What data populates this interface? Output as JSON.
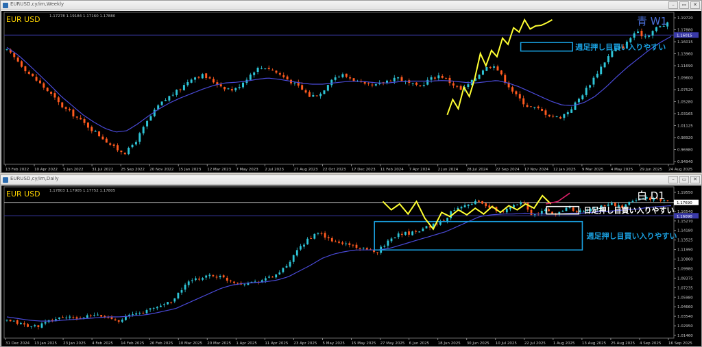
{
  "windows": [
    {
      "id": "weekly",
      "title": "EURUSD,cy/im,Weekly",
      "symbol_label": "EUR USD",
      "ohlc_text": "1.17278 1.19184 1.17160 1.17880",
      "corner_label": "青 W1",
      "annotation": "週足押し目買い入りやすい",
      "price_ticks": [
        "1.19720",
        "1.17880",
        "1.16015",
        "1.13960",
        "1.11690",
        "1.09600",
        "1.07520",
        "1.05280",
        "1.03165",
        "1.01125",
        "0.98920",
        "0.96980",
        "0.94940"
      ],
      "date_ticks": [
        "13 Feb 2022",
        "10 Apr 2022",
        "5 Jun 2022",
        "31 Jul 2022",
        "25 Sep 2022",
        "20 Nov 2022",
        "15 Jan 2023",
        "12 Mar 2023",
        "7 May 2023",
        "2 Jul 2023",
        "27 Aug 2023",
        "22 Oct 2023",
        "17 Dec 2023",
        "11 Feb 2024",
        "7 Apr 2024",
        "2 Jun 2024",
        "28 Jul 2024",
        "22 Sep 2024",
        "17 Nov 2024",
        "12 Jan 2025",
        "9 Mar 2025",
        "4 May 2025",
        "29 Jun 2025",
        "24 Aug 2025"
      ],
      "colors": {
        "up": "#2ec4d6",
        "down": "#ff5a1f",
        "ma": "#4a4ad8",
        "zigzag": "#ffff33",
        "zone": "#1aa0e0",
        "hline": "#3a3aa8"
      }
    },
    {
      "id": "daily",
      "title": "EURUSD,cy/im,Daily",
      "symbol_label": "EUR USD",
      "ohlc_text": "1.17803 1.17905 1.17752 1.17805",
      "corner_label": "白 D1",
      "annotation_white": "日足押し目買い入りやすい",
      "annotation_blue": "週足押し目買い入りやすい",
      "price_ticks": [
        "1.19550",
        "1.17690",
        "1.16540",
        "1.15270",
        "1.14180",
        "1.13525",
        "1.11990",
        "1.10860",
        "1.09980",
        "1.08375",
        "1.07235",
        "1.05980",
        "1.04660",
        "1.03540",
        "1.02950",
        "1.01460"
      ],
      "date_ticks": [
        "31 Dec 2024",
        "13 Jan 2025",
        "23 Jan 2025",
        "4 Feb 2025",
        "14 Feb 2025",
        "26 Feb 2025",
        "10 Mar 2025",
        "20 Mar 2025",
        "1 Apr 2025",
        "11 Apr 2025",
        "23 Apr 2025",
        "5 May 2025",
        "15 May 2025",
        "27 May 2025",
        "6 Jun 2025",
        "18 Jun 2025",
        "30 Jun 2025",
        "10 Jul 2025",
        "22 Jul 2025",
        "1 Aug 2025",
        "13 Aug 2025",
        "25 Aug 2025",
        "4 Sep 2025",
        "16 Sep 2025"
      ],
      "colors": {
        "up": "#2ec4d6",
        "down": "#ff5a1f",
        "ma": "#4a4ad8",
        "zigzag": "#ffff33",
        "zone_white": "#ffffff",
        "zone_blue": "#1aa0e0",
        "forecast": "#e0206a",
        "hline_white": "#bdbdbd",
        "hline_blue": "#3a3aa8"
      }
    }
  ],
  "chart_data": [
    {
      "type": "candlestick",
      "title": "EUR USD",
      "timeframe": "W1",
      "x_range": [
        "13 Feb 2022",
        "24 Aug 2025"
      ],
      "ylim": [
        0.9494,
        1.1972
      ],
      "close_path": [
        1.135,
        1.118,
        1.098,
        1.082,
        1.065,
        1.045,
        1.032,
        1.018,
        1.004,
        0.99,
        0.975,
        0.968,
        0.99,
        1.02,
        1.045,
        1.06,
        1.072,
        1.09,
        1.095,
        1.085,
        1.075,
        1.07,
        1.087,
        1.105,
        1.108,
        1.098,
        1.087,
        1.075,
        1.06,
        1.065,
        1.09,
        1.095,
        1.088,
        1.078,
        1.077,
        1.085,
        1.092,
        1.082,
        1.075,
        1.088,
        1.095,
        1.082,
        1.07,
        1.085,
        1.105,
        1.112,
        1.085,
        1.062,
        1.045,
        1.04,
        1.03,
        1.025,
        1.038,
        1.06,
        1.085,
        1.112,
        1.136,
        1.142,
        1.165,
        1.158,
        1.172,
        1.178
      ],
      "ma_path": [
        1.14,
        1.128,
        1.112,
        1.095,
        1.078,
        1.06,
        1.045,
        1.03,
        1.018,
        1.008,
        1.002,
        1.004,
        1.015,
        1.028,
        1.04,
        1.05,
        1.058,
        1.065,
        1.072,
        1.078,
        1.082,
        1.083,
        1.085,
        1.088,
        1.09,
        1.088,
        1.085,
        1.082,
        1.08,
        1.08,
        1.082,
        1.084,
        1.085,
        1.084,
        1.082,
        1.082,
        1.084,
        1.085,
        1.085,
        1.085,
        1.086,
        1.085,
        1.083,
        1.082,
        1.084,
        1.086,
        1.082,
        1.076,
        1.068,
        1.06,
        1.052,
        1.046,
        1.045,
        1.05,
        1.06,
        1.075,
        1.092,
        1.108,
        1.122,
        1.136,
        1.148,
        1.158
      ],
      "zigzag": [
        1.03,
        1.055,
        1.04,
        1.075,
        1.06,
        1.09,
        1.13,
        1.11,
        1.135,
        1.125,
        1.155,
        1.145,
        1.172,
        1.165,
        1.185,
        1.17,
        1.175,
        1.176,
        1.18,
        1.185
      ],
      "hline": 1.16015,
      "zone": {
        "from": 1.134,
        "to": 1.148,
        "label": "週足押し目買い入りやすい"
      }
    },
    {
      "type": "candlestick",
      "title": "EUR USD",
      "timeframe": "D1",
      "x_range": [
        "31 Dec 2024",
        "16 Sep 2025"
      ],
      "ylim": [
        1.0146,
        1.1955
      ],
      "close_path": [
        1.035,
        1.033,
        1.028,
        1.03,
        1.036,
        1.04,
        1.038,
        1.04,
        1.042,
        1.039,
        1.036,
        1.042,
        1.045,
        1.05,
        1.055,
        1.062,
        1.08,
        1.085,
        1.09,
        1.088,
        1.083,
        1.08,
        1.082,
        1.085,
        1.09,
        1.1,
        1.12,
        1.135,
        1.14,
        1.13,
        1.128,
        1.125,
        1.12,
        1.118,
        1.13,
        1.14,
        1.14,
        1.145,
        1.15,
        1.155,
        1.17,
        1.175,
        1.178,
        1.172,
        1.165,
        1.17,
        1.18,
        1.16,
        1.168,
        1.162,
        1.172,
        1.165,
        1.168,
        1.172,
        1.175,
        1.17,
        1.18,
        1.183,
        1.18,
        1.178
      ],
      "ma_path": [
        1.04,
        1.038,
        1.036,
        1.035,
        1.035,
        1.036,
        1.037,
        1.038,
        1.039,
        1.04,
        1.04,
        1.041,
        1.042,
        1.044,
        1.047,
        1.05,
        1.056,
        1.062,
        1.068,
        1.074,
        1.078,
        1.08,
        1.081,
        1.082,
        1.084,
        1.088,
        1.095,
        1.102,
        1.11,
        1.115,
        1.118,
        1.12,
        1.12,
        1.12,
        1.122,
        1.126,
        1.13,
        1.134,
        1.138,
        1.142,
        1.148,
        1.154,
        1.16,
        1.162,
        1.163,
        1.163,
        1.164,
        1.163,
        1.163,
        1.163,
        1.164,
        1.164,
        1.165,
        1.166,
        1.167,
        1.168,
        1.169,
        1.171,
        1.172,
        1.173
      ],
      "zigzag": [
        1.178,
        1.168,
        1.175,
        1.163,
        1.178,
        1.158,
        1.145,
        1.165,
        1.16,
        1.168,
        1.162,
        1.17,
        1.163,
        1.172,
        1.165,
        1.173,
        1.168,
        1.175,
        1.17,
        1.185,
        1.175
      ],
      "forecast": [
        1.175,
        1.178,
        1.188
      ],
      "hline_white": 1.1769,
      "hline_blue": 1.1609,
      "zone_white": {
        "from": 1.163,
        "to": 1.172,
        "label": "日足押し目買い入りやすい"
      },
      "zone_blue": {
        "from": 1.12,
        "to": 1.154,
        "label": "週足押し目買い入りやすい"
      }
    }
  ]
}
